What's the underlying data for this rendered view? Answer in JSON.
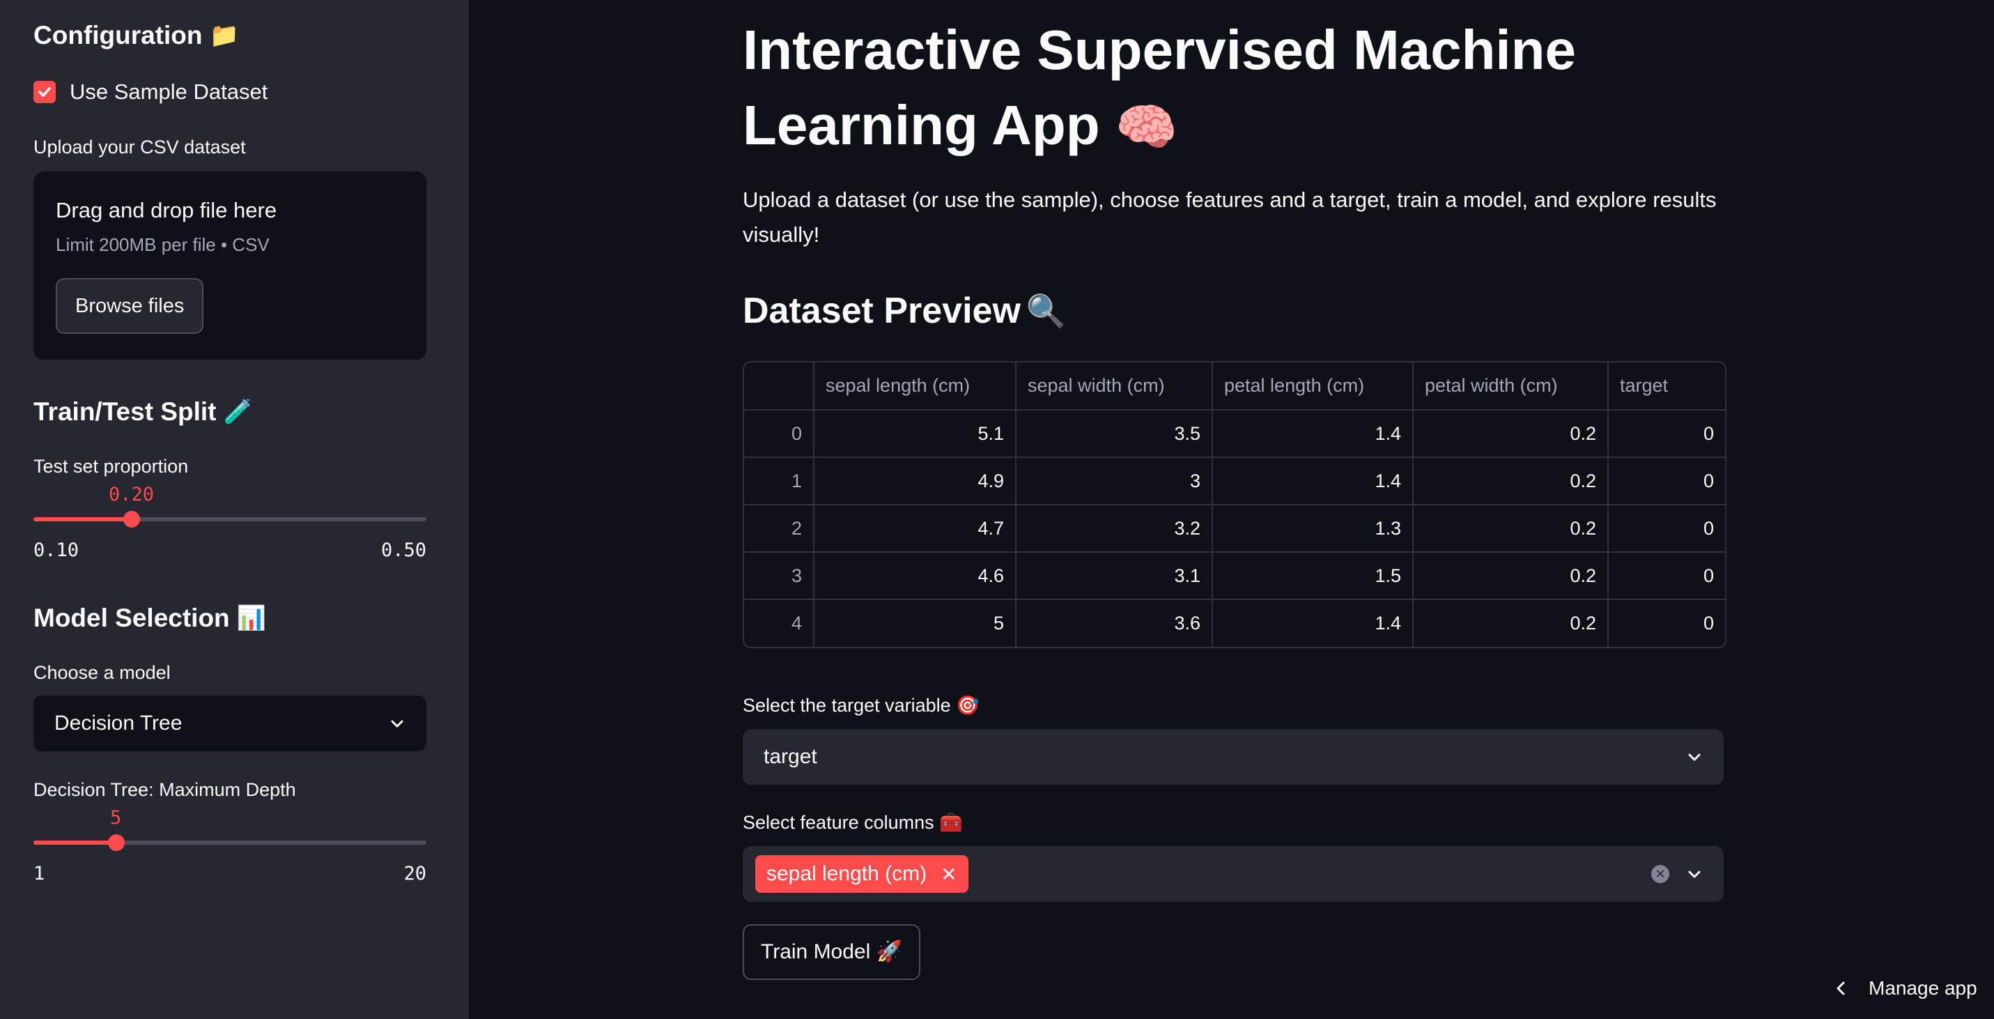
{
  "sidebar": {
    "config_title": "Configuration",
    "config_icon": "folder-icon",
    "use_sample_label": "Use Sample Dataset",
    "use_sample_checked": true,
    "upload_label": "Upload your CSV dataset",
    "dropzone_title": "Drag and drop file here",
    "dropzone_limit": "Limit 200MB per file • CSV",
    "browse_label": "Browse files",
    "split_title": "Train/Test Split",
    "split_icon": "test-tube-icon",
    "test_label": "Test set proportion",
    "test_value": "0.20",
    "test_min": "0.10",
    "test_max": "0.50",
    "model_title": "Model Selection",
    "model_icon": "bar-chart-icon",
    "choose_model_label": "Choose a model",
    "model_value": "Decision Tree",
    "depth_label": "Decision Tree: Maximum Depth",
    "depth_value": "5",
    "depth_min": "1",
    "depth_max": "20"
  },
  "main": {
    "title": "Interactive Supervised Machine Learning App",
    "title_icon": "brain-icon",
    "intro": "Upload a dataset (or use the sample), choose features and a target, train a model, and explore results visually!",
    "preview_title": "Dataset Preview",
    "preview_icon": "magnifier-icon",
    "table": {
      "columns": [
        "",
        "sepal length (cm)",
        "sepal width (cm)",
        "petal length (cm)",
        "petal width (cm)",
        "target"
      ],
      "rows": [
        [
          "0",
          "5.1",
          "3.5",
          "1.4",
          "0.2",
          "0"
        ],
        [
          "1",
          "4.9",
          "3",
          "1.4",
          "0.2",
          "0"
        ],
        [
          "2",
          "4.7",
          "3.2",
          "1.3",
          "0.2",
          "0"
        ],
        [
          "3",
          "4.6",
          "3.1",
          "1.5",
          "0.2",
          "0"
        ],
        [
          "4",
          "5",
          "3.6",
          "1.4",
          "0.2",
          "0"
        ]
      ]
    },
    "target_label": "Select the target variable",
    "target_icon": "dart-icon",
    "target_value": "target",
    "features_label": "Select feature columns",
    "features_icon": "toolbox-icon",
    "features_selected": [
      "sepal length (cm)"
    ],
    "train_label": "Train Model",
    "train_icon": "rocket-icon"
  },
  "footer": {
    "manage_label": "Manage app"
  },
  "colors": {
    "accent": "#ff4b4b",
    "background": "#0e1117",
    "sidebar": "#262730"
  }
}
